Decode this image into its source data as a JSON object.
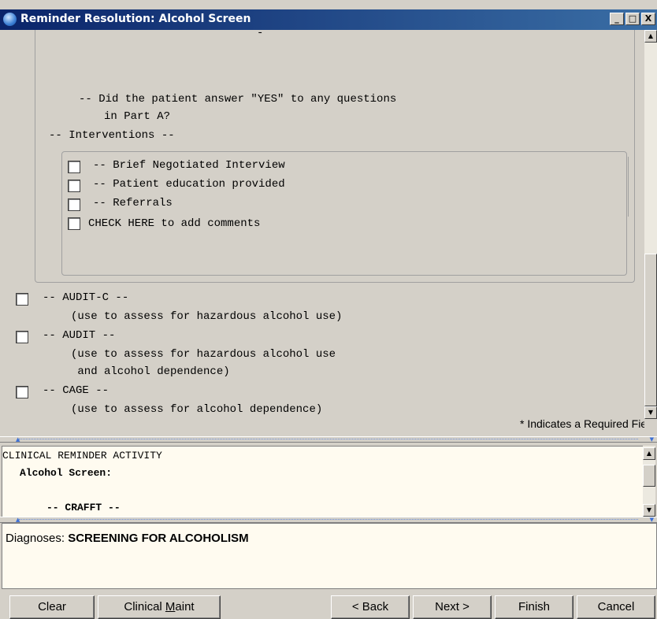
{
  "window": {
    "title": "Reminder Resolution: Alcohol Screen",
    "controls": {
      "minimize": "_",
      "maximize": "□",
      "close": "X"
    }
  },
  "dialog": {
    "top_fragment": "-",
    "question_line1": "-- Did the patient answer \"YES\" to any questions",
    "question_line2": "in Part A?",
    "interventions_header": "-- Interventions --",
    "interventions": [
      {
        "label": "-- Brief Negotiated Interview",
        "checked": false
      },
      {
        "label": "-- Patient education provided",
        "checked": false
      },
      {
        "label": "-- Referrals",
        "checked": false
      },
      {
        "label": "CHECK HERE to add comments",
        "checked": false
      }
    ],
    "options": [
      {
        "title": "-- AUDIT-C --",
        "desc1": "(use to assess for hazardous alcohol use)",
        "desc2": "",
        "checked": false
      },
      {
        "title": "-- AUDIT --",
        "desc1": "(use to assess for hazardous alcohol use",
        "desc2": " and alcohol dependence)",
        "checked": false
      },
      {
        "title": "-- CAGE --",
        "desc1": "(use to assess for alcohol dependence)",
        "desc2": "",
        "checked": false
      }
    ],
    "required_note": "* Indicates a Required Field"
  },
  "activity": {
    "line1": "CLINICAL REMINDER ACTIVITY",
    "line2": "Alcohol Screen:",
    "line3": "-- CRAFFT --"
  },
  "diagnoses": {
    "label": "Diagnoses:",
    "value": "SCREENING FOR ALCOHOLISM"
  },
  "buttons": {
    "clear": "Clear",
    "clinical_maint_pre": "Clinical ",
    "clinical_maint_accel": "M",
    "clinical_maint_post": "aint",
    "back": "< Back",
    "next": "Next >",
    "finish": "Finish",
    "cancel": "Cancel"
  },
  "colors": {
    "title_gradient_start": "#0a246a",
    "title_gradient_end": "#3a6ea5",
    "pane_background": "#fffbf0",
    "window_face": "#d4d0c8"
  }
}
